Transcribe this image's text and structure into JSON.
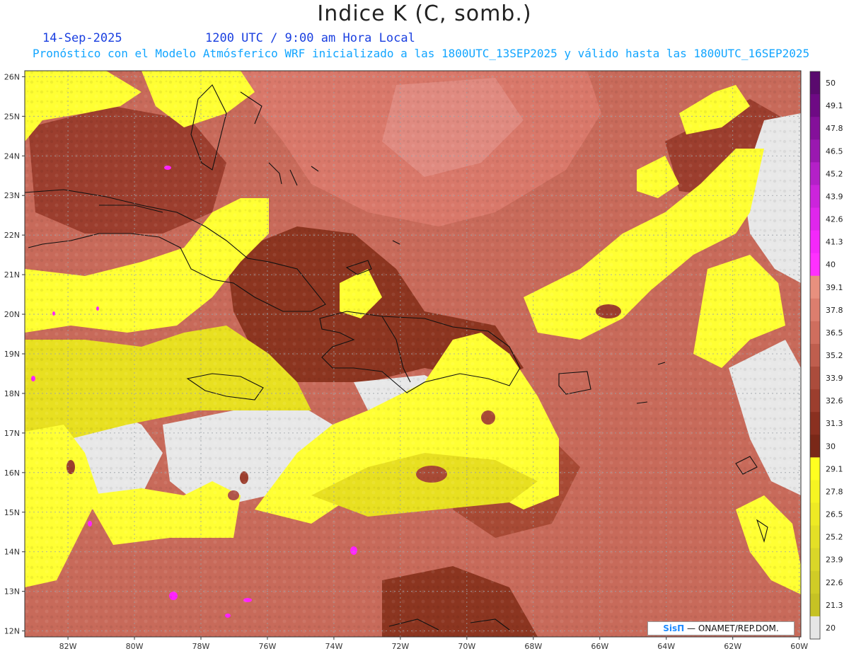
{
  "header": {
    "title": "Indice K (C, somb.)",
    "date": "14-Sep-2025",
    "time": "1200 UTC / 9:00 am Hora Local",
    "subtitle": "Pronóstico con el Modelo Atmósferico WRF inicializado a las 1800UTC_13SEP2025 y válido hasta las  1800UTC_16SEP2025"
  },
  "map": {
    "lat_labels": [
      "12N",
      "13N",
      "14N",
      "15N",
      "16N",
      "17N",
      "18N",
      "19N",
      "20N",
      "21N",
      "22N",
      "23N",
      "24N",
      "25N",
      "26N"
    ],
    "lon_labels": [
      "82W",
      "80W",
      "78W",
      "76W",
      "74W",
      "72W",
      "70W",
      "68W",
      "66W",
      "64W",
      "62W",
      "60W"
    ],
    "colors": {
      "land_no_data": "#e8e8e8",
      "yellow_high": "#ffff33",
      "yellow_mid": "#e8e020",
      "brown_dark": "#8c3520",
      "brown_mid": "#a84a35",
      "salmon": "#c86a5a",
      "pink_light": "#e08a80",
      "magenta": "#ff22ff",
      "coast": "#111111"
    }
  },
  "colorbar": {
    "labels": [
      "50",
      "49.1",
      "47.8",
      "46.5",
      "45.2",
      "43.9",
      "42.6",
      "41.3",
      "40",
      "39.1",
      "37.8",
      "36.5",
      "35.2",
      "33.9",
      "32.6",
      "31.3",
      "30",
      "29.1",
      "27.8",
      "26.5",
      "25.2",
      "23.9",
      "22.6",
      "21.3",
      "20"
    ],
    "colors": [
      "#5a0a6e",
      "#6e0a84",
      "#84109a",
      "#9a18b0",
      "#b420c8",
      "#cc24dc",
      "#e026ec",
      "#f428fa",
      "#ff30ff",
      "#e8907e",
      "#dc7e6e",
      "#cf6e5e",
      "#bf5e4e",
      "#ab4c3c",
      "#9c3e2e",
      "#8a3020",
      "#7a2818",
      "#ffff20",
      "#f6f422",
      "#eeea24",
      "#e4e026",
      "#dad628",
      "#d0cc26",
      "#c6c224",
      "#e6e6e6"
    ]
  },
  "credit": {
    "sis": "SisΠ",
    "rest": " — ONAMET/REP.DOM."
  }
}
